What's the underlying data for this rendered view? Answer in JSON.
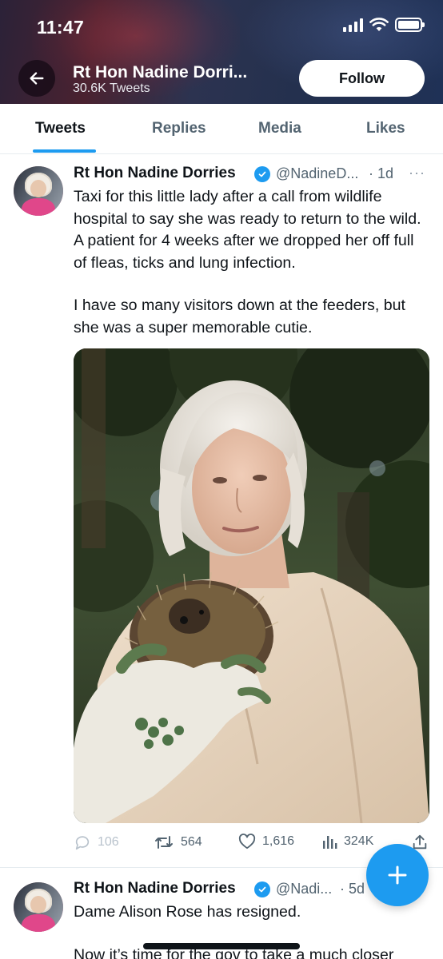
{
  "status_bar": {
    "time": "11:47"
  },
  "header": {
    "title": "Rt Hon Nadine Dorri...",
    "tweet_count": "30.6K Tweets",
    "follow_label": "Follow"
  },
  "tabs": [
    {
      "label": "Tweets",
      "active": true
    },
    {
      "label": "Replies",
      "active": false
    },
    {
      "label": "Media",
      "active": false
    },
    {
      "label": "Likes",
      "active": false
    }
  ],
  "tweets": [
    {
      "name": "Rt Hon Nadine Dorries",
      "handle": "@NadineD...",
      "time": "· 1d",
      "more": "···",
      "text_1": "Taxi for this little lady after a call from wildlife hospital to say she was ready to return to the wild. A patient for 4 weeks after we dropped her off full of fleas, ticks and lung infection.",
      "text_2": "I have so many visitors down at the feeders, but she was a super memorable cutie.",
      "replies": "106",
      "retweets": "564",
      "likes": "1,616",
      "views": "324K"
    },
    {
      "name": "Rt Hon Nadine Dorries",
      "handle": "@Nadi...",
      "time": "· 5d",
      "text_1": "Dame Alison Rose has resigned.",
      "text_2": "Now it’s time for the gov to take a much closer"
    }
  ],
  "colors": {
    "accent": "#1d9bf0",
    "text": "#0f1419",
    "secondary": "#536471"
  },
  "icons": {
    "back": "arrow-left-icon",
    "verified": "verified-badge-icon",
    "reply": "reply-icon",
    "retweet": "retweet-icon",
    "like": "heart-icon",
    "views": "views-icon",
    "share": "share-icon",
    "compose": "plus-icon"
  }
}
